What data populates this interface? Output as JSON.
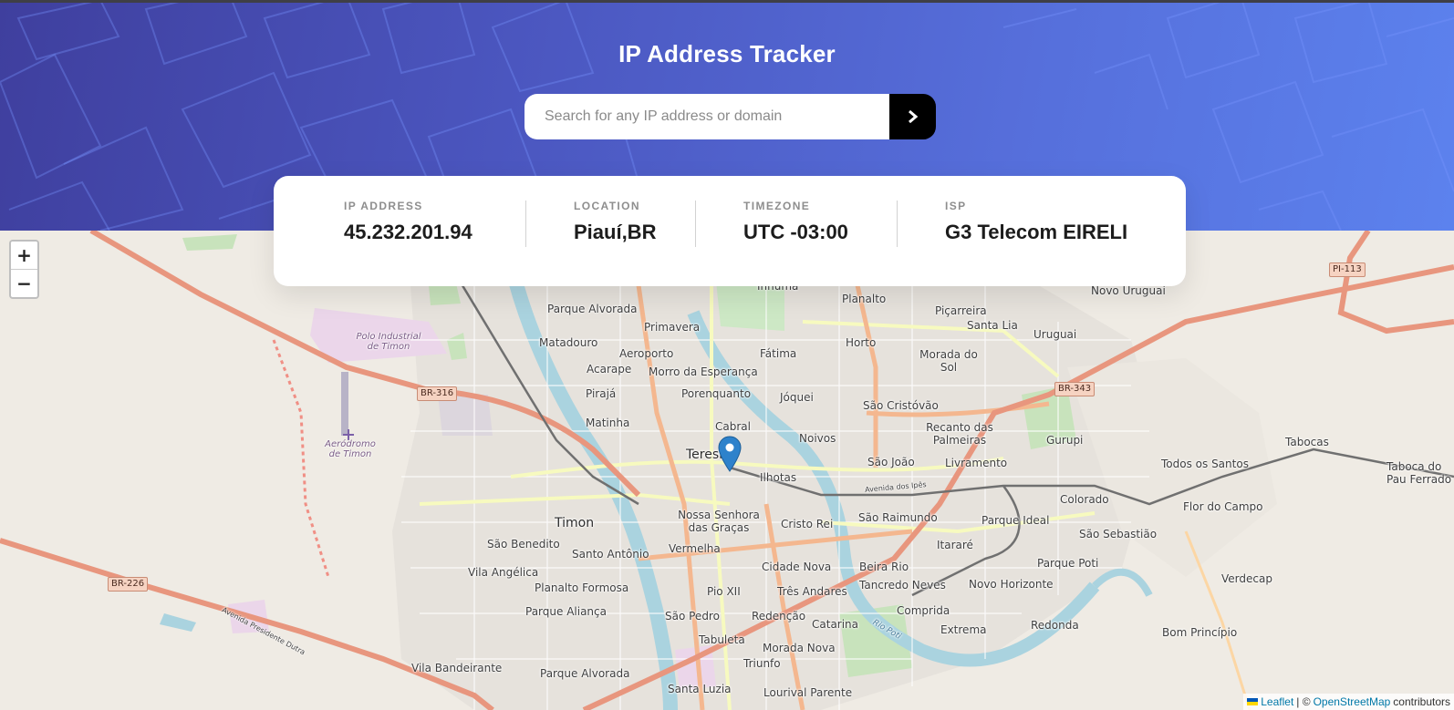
{
  "app": {
    "title": "IP Address Tracker"
  },
  "search": {
    "placeholder": "Search for any IP address or domain",
    "value": "",
    "button_icon": "chevron-right-icon"
  },
  "info": {
    "ip_label": "IP ADDRESS",
    "ip_value": "45.232.201.94",
    "location_label": "LOCATION",
    "location_value": "Piauí,BR",
    "timezone_label": "TIMEZONE",
    "timezone_value": "UTC -03:00",
    "isp_label": "ISP",
    "isp_value": "G3 Telecom EIRELI"
  },
  "map": {
    "zoom_in_label": "+",
    "zoom_out_label": "−",
    "marker_icon": "map-marker-icon",
    "attribution": {
      "leaflet": "Leaflet",
      "separator": "| ©",
      "osm": "OpenStreetMap",
      "contributors": "contributors"
    },
    "shields": [
      "PI-113",
      "BR-316",
      "BR-343",
      "BR-226"
    ],
    "labels": {
      "inhuma": "Inhuma",
      "planalto": "Planalto",
      "novo_uruguai": "Novo Uruguai",
      "parque_alvorada_n": "Parque Alvorada",
      "picarreira": "Piçarreira",
      "primavera": "Primavera",
      "santa_lia": "Santa Lia",
      "uruguai": "Uruguai",
      "matadouro": "Matadouro",
      "aeroporto": "Aeroporto",
      "horto": "Horto",
      "fatima": "Fátima",
      "morada_do_sol": "Morada do Sol",
      "polo_industrial": "Polo Industrial de Timon",
      "acarape": "Acarape",
      "morro": "Morro da Esperança",
      "piraja": "Pirajá",
      "porenquanto": "Porenquanto",
      "joquei": "Jóquei",
      "sao_cristovao": "São Cristóvão",
      "matinha": "Matinha",
      "cabral": "Cabral",
      "recanto": "Recanto das Palmeiras",
      "aerodromo": "Aeródromo de Timon",
      "teresina": "Teresina",
      "noivos": "Noivos",
      "sao_joao": "São João",
      "livramento": "Livramento",
      "gurupi": "Gurupi",
      "tabocas": "Tabocas",
      "todos_os_santos": "Todos os Santos",
      "taboca": "Taboca do Pau Ferrado",
      "ilhotas": "Ilhotas",
      "colorado": "Colorado",
      "flor_do_campo": "Flor do Campo",
      "nossa_senhora": "Nossa Senhora das Graças",
      "sao_raimundo": "São Raimundo",
      "parque_ideal": "Parque Ideal",
      "timon": "Timon",
      "cristo_rei": "Cristo Rei",
      "sao_sebastiao": "São Sebastião",
      "sao_benedito": "São Benedito",
      "santo_antonio": "Santo Antônio",
      "vermelha": "Vermelha",
      "itarare": "Itararé",
      "parque_poti": "Parque Poti",
      "vila_angelica": "Vila Angélica",
      "cidade_nova": "Cidade Nova",
      "beira_rio": "Beira Rio",
      "verdecap": "Verdecap",
      "planalto_formosa": "Planalto Formosa",
      "tancredo": "Tancredo Neves",
      "novo_horizonte": "Novo Horizonte",
      "pio_xii": "Pio XII",
      "tres_andares": "Três Andares",
      "parque_alianca": "Parque Aliança",
      "compida": "Comprida",
      "sao_pedro": "São Pedro",
      "redencao": "Redenção",
      "catarina": "Catarina",
      "extrema": "Extrema",
      "redonda": "Redonda",
      "bom_principio": "Bom Princípio",
      "tabuleta": "Tabuleta",
      "morada_nova": "Morada Nova",
      "vila_bandeirante": "Vila Bandeirante",
      "parque_alvorada_s": "Parque Alvorada",
      "triunfo": "Triunfo",
      "santa_luzia": "Santa Luzia",
      "lourival": "Lourival Parente",
      "avenida_dos_ipes": "Avenida dos Ipês",
      "rio_poti": "Rio Poti",
      "av_pres_dutra": "Avenida Presidente Dutra"
    }
  }
}
